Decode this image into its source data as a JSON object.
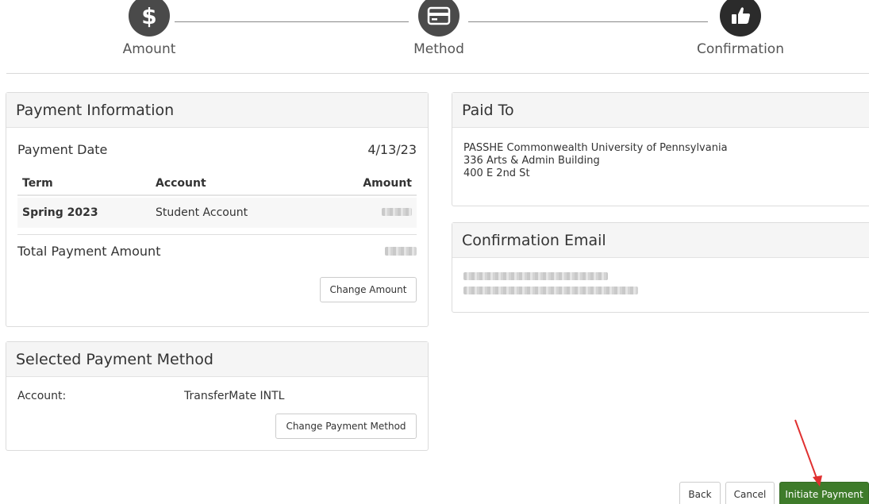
{
  "stepper": {
    "steps": [
      {
        "label": "Amount",
        "icon": "dollar-icon"
      },
      {
        "label": "Method",
        "icon": "credit-card-icon"
      },
      {
        "label": "Confirmation",
        "icon": "thumbs-up-icon"
      }
    ]
  },
  "payment_info": {
    "title": "Payment Information",
    "date_label": "Payment Date",
    "date_value": "4/13/23",
    "columns": {
      "term": "Term",
      "account": "Account",
      "amount": "Amount"
    },
    "rows": [
      {
        "term": "Spring 2023",
        "account": "Student Account",
        "amount": ""
      }
    ],
    "total_label": "Total Payment Amount",
    "total_value": "",
    "change_amount_label": "Change Amount"
  },
  "selected_method": {
    "title": "Selected Payment Method",
    "account_label": "Account:",
    "account_value": "TransferMate INTL",
    "change_method_label": "Change Payment Method"
  },
  "paid_to": {
    "title": "Paid To",
    "lines": [
      "PASSHE Commonwealth University of Pennsylvania",
      "336 Arts & Admin Building",
      "400 E 2nd St"
    ]
  },
  "confirmation_email": {
    "title": "Confirmation Email"
  },
  "footer": {
    "back_label": "Back",
    "cancel_label": "Cancel",
    "initiate_label": "Initiate Payment"
  },
  "colors": {
    "primary_green": "#3e7b2a",
    "step_circle": "#4a4a4a",
    "arrow": "#e03030"
  }
}
